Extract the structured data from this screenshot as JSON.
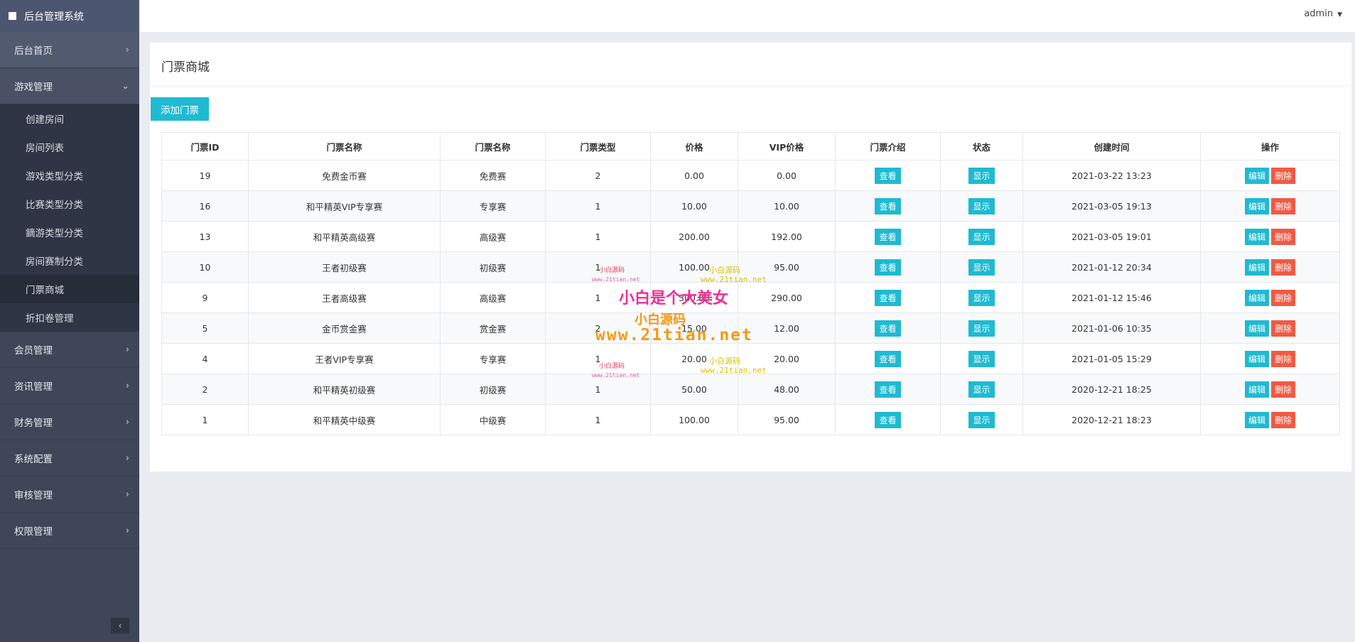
{
  "app": {
    "title": "后台管理系统"
  },
  "user": {
    "name": "admin"
  },
  "sidebar": {
    "items": [
      {
        "label": "后台首页"
      },
      {
        "label": "游戏管理"
      },
      {
        "label": "会员管理"
      },
      {
        "label": "资讯管理"
      },
      {
        "label": "财务管理"
      },
      {
        "label": "系统配置"
      },
      {
        "label": "审核管理"
      },
      {
        "label": "权限管理"
      }
    ],
    "game_sub": [
      {
        "label": "创建房间"
      },
      {
        "label": "房间列表"
      },
      {
        "label": "游戏类型分类"
      },
      {
        "label": "比赛类型分类"
      },
      {
        "label": "鏑游类型分类"
      },
      {
        "label": "房间赛制分类"
      },
      {
        "label": "门票商城"
      },
      {
        "label": "折扣卷管理"
      }
    ]
  },
  "page": {
    "title": "门票商城",
    "add_button": "添加门票"
  },
  "table": {
    "headers": [
      "门票ID",
      "门票名称",
      "门票名称",
      "门票类型",
      "价格",
      "VIP价格",
      "门票介绍",
      "状态",
      "创建时间",
      "操作"
    ],
    "view_label": "查看",
    "status_label": "显示",
    "edit_label": "编辑",
    "delete_label": "删除",
    "rows": [
      {
        "id": "19",
        "name": "免费金币赛",
        "name2": "免费赛",
        "type": "2",
        "price": "0.00",
        "vip": "0.00",
        "time": "2021-03-22 13:23"
      },
      {
        "id": "16",
        "name": "和平精英VIP专享赛",
        "name2": "专享赛",
        "type": "1",
        "price": "10.00",
        "vip": "10.00",
        "time": "2021-03-05 19:13"
      },
      {
        "id": "13",
        "name": "和平精英高级赛",
        "name2": "高级赛",
        "type": "1",
        "price": "200.00",
        "vip": "192.00",
        "time": "2021-03-05 19:01"
      },
      {
        "id": "10",
        "name": "王者初级赛",
        "name2": "初级赛",
        "type": "1",
        "price": "100.00",
        "vip": "95.00",
        "time": "2021-01-12 20:34"
      },
      {
        "id": "9",
        "name": "王者高级赛",
        "name2": "高级赛",
        "type": "1",
        "price": "300.00",
        "vip": "290.00",
        "time": "2021-01-12 15:46"
      },
      {
        "id": "5",
        "name": "金币赏金赛",
        "name2": "赏金赛",
        "type": "2",
        "price": "15.00",
        "vip": "12.00",
        "time": "2021-01-06 10:35"
      },
      {
        "id": "4",
        "name": "王者VIP专享赛",
        "name2": "专享赛",
        "type": "1",
        "price": "20.00",
        "vip": "20.00",
        "time": "2021-01-05 15:29"
      },
      {
        "id": "2",
        "name": "和平精英初级赛",
        "name2": "初级赛",
        "type": "1",
        "price": "50.00",
        "vip": "48.00",
        "time": "2020-12-21 18:25"
      },
      {
        "id": "1",
        "name": "和平精英中级赛",
        "name2": "中级赛",
        "type": "1",
        "price": "100.00",
        "vip": "95.00",
        "time": "2020-12-21 18:23"
      }
    ]
  },
  "watermark": {
    "small_cn": "小白源码",
    "small_url": "www.21tian.net",
    "big_text": "小白是个大美女",
    "orange_cn": "小白源码",
    "orange_url": "www.21tian.net"
  }
}
